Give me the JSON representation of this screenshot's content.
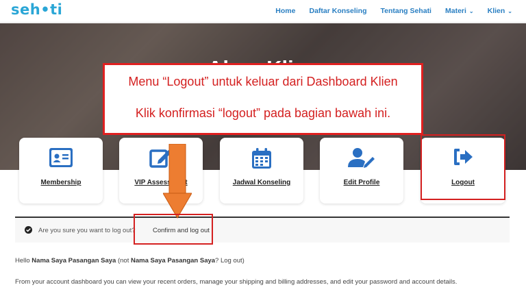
{
  "header": {
    "logo": "seh•ti",
    "nav": [
      {
        "label": "Home",
        "has_dropdown": false
      },
      {
        "label": "Daftar Konseling",
        "has_dropdown": false
      },
      {
        "label": "Tentang Sehati",
        "has_dropdown": false
      },
      {
        "label": "Materi",
        "has_dropdown": true
      },
      {
        "label": "Klien",
        "has_dropdown": true
      }
    ]
  },
  "hero": {
    "title": "Akun Klien"
  },
  "callout": {
    "line1": "Menu “Logout” untuk keluar dari Dashboard Klien",
    "line2": "Klik konfirmasi “logout” pada bagian bawah ini."
  },
  "cards": [
    {
      "label": "Membership",
      "icon": "id-card-icon"
    },
    {
      "label": "VIP Assessment",
      "icon": "edit-square-icon"
    },
    {
      "label": "Jadwal Konseling",
      "icon": "calendar-icon"
    },
    {
      "label": "Edit Profile",
      "icon": "user-edit-icon"
    },
    {
      "label": "Logout",
      "icon": "sign-out-icon"
    }
  ],
  "notice": {
    "message": "Are you sure you want to log out?",
    "confirm_link": "Confirm and log out"
  },
  "greeting": {
    "prefix": "Hello ",
    "name": "Nama Saya Pasangan Saya",
    "mid": " (not ",
    "name2": "Nama Saya Pasangan Saya",
    "logout_link": "? Log out",
    "suffix": ")"
  },
  "dashboard_text": {
    "p1": "From your account dashboard you can view your ",
    "recent_orders": "recent orders",
    "p2": ", manage your ",
    "addresses": "shipping and billing addresses",
    "p3": ", and ",
    "account_details": "edit your password and account details",
    "p4": "."
  },
  "colors": {
    "accent": "#2a7fc2",
    "logo": "#2aa6d6",
    "highlight_red": "#d42020",
    "arrow_orange": "#ed7d31"
  }
}
